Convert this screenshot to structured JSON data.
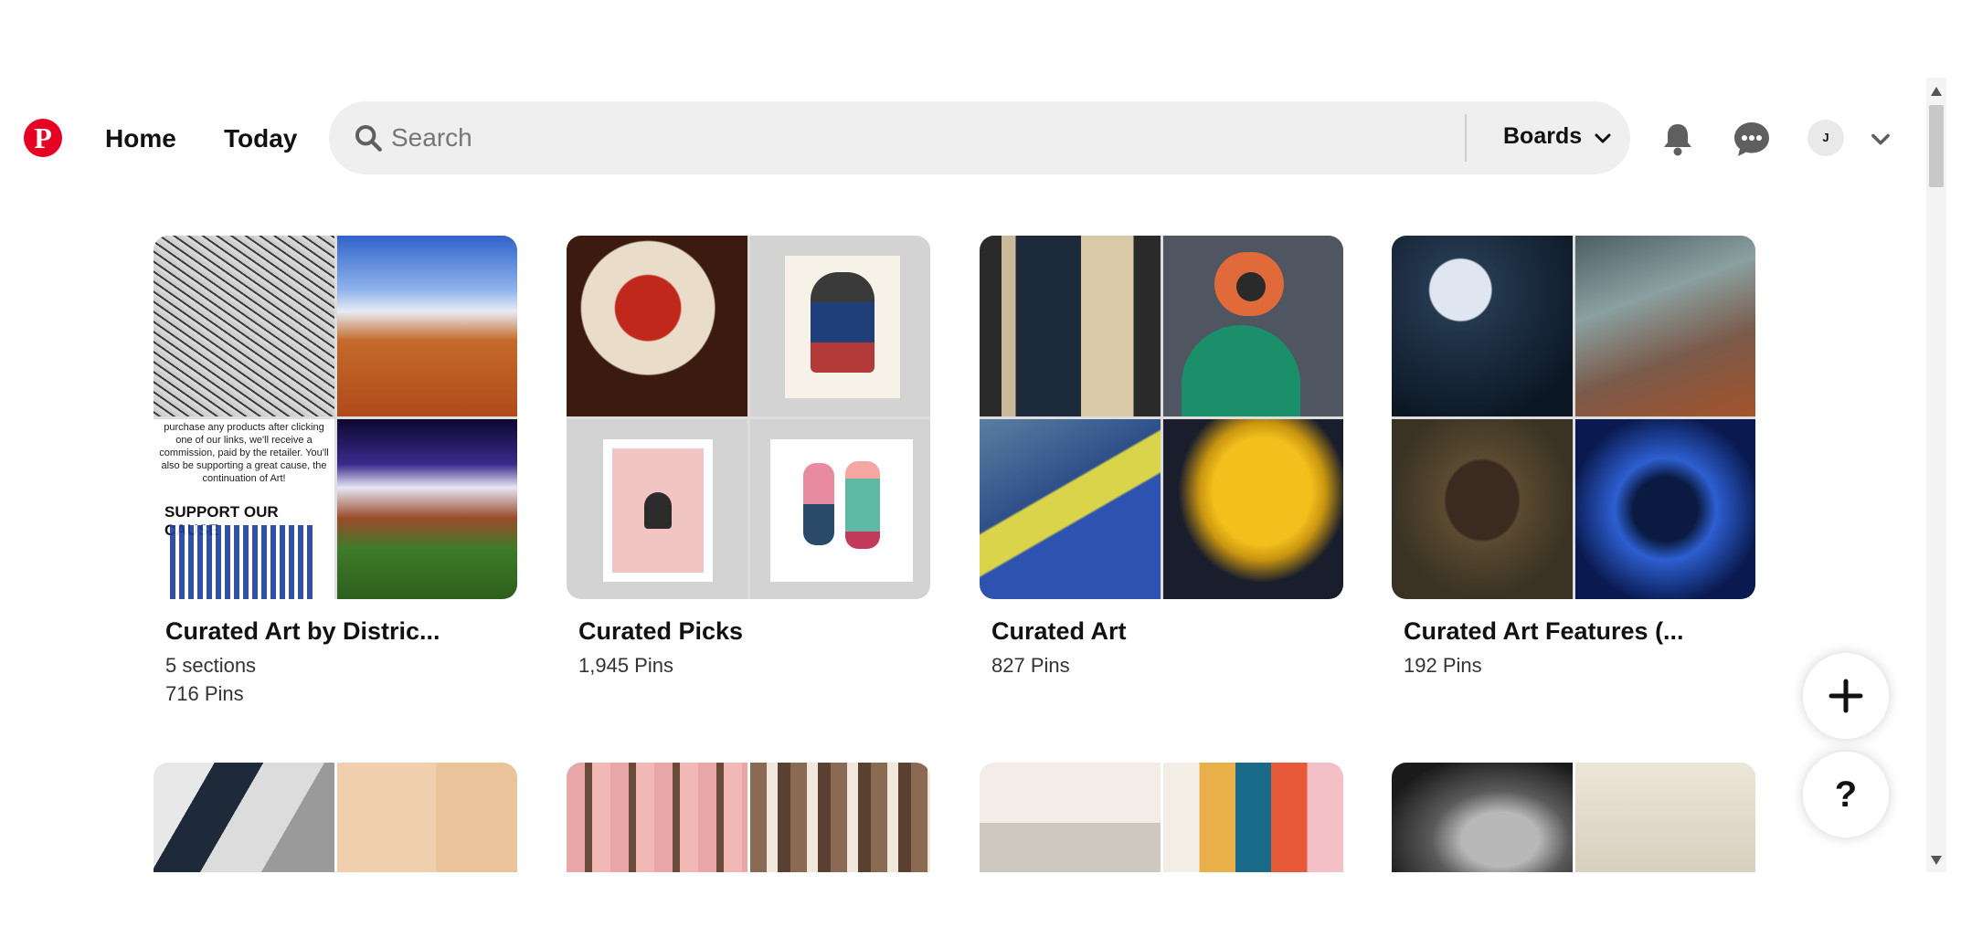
{
  "header": {
    "nav": {
      "home": "Home",
      "today": "Today"
    },
    "search": {
      "placeholder": "Search",
      "value": ""
    },
    "scope_label": "Boards",
    "avatar_initial": "J"
  },
  "boards": [
    {
      "title": "Curated Art by Distric...",
      "meta1": "5 sections",
      "meta2": "716 Pins",
      "cover_text": {
        "body": "purchase any products after clicking one of our links, we'll receive a commission, paid by the retailer.  You'll also be supporting a great cause, the continuation of Art!",
        "heading": "SUPPORT OUR CAUSE"
      }
    },
    {
      "title": "Curated Picks",
      "meta1": "1,945 Pins",
      "meta2": ""
    },
    {
      "title": "Curated Art",
      "meta1": "827 Pins",
      "meta2": ""
    },
    {
      "title": "Curated Art Features (...",
      "meta1": "192 Pins",
      "meta2": ""
    }
  ],
  "fab": {
    "help_label": "?"
  },
  "colors": {
    "brand": "#e60023",
    "search_bg": "#efefef"
  },
  "icons": [
    "pinterest-logo-icon",
    "search-icon",
    "chevron-down-icon",
    "bell-icon",
    "chat-icon",
    "plus-icon"
  ]
}
